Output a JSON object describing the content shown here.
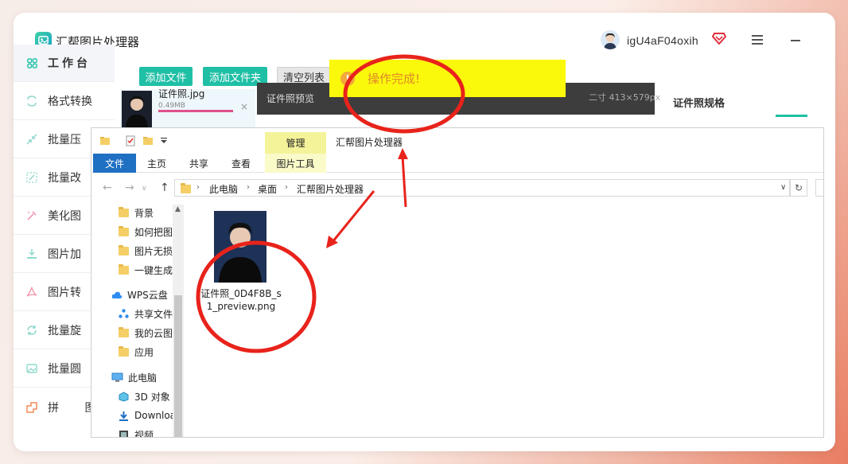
{
  "app": {
    "title": "汇帮图片处理器",
    "username": "igU4aF04oxih"
  },
  "sidebar": {
    "items": [
      {
        "label": "工作台",
        "icon": "grid-icon"
      },
      {
        "label": "格式转换",
        "icon": "convert-icon"
      },
      {
        "label": "批量压",
        "icon": "compress-icon"
      },
      {
        "label": "批量改",
        "icon": "resize-icon"
      },
      {
        "label": "美化图",
        "icon": "beautify-icon"
      },
      {
        "label": "图片加",
        "icon": "watermark-icon"
      },
      {
        "label": "图片转",
        "icon": "pdf-icon"
      },
      {
        "label": "批量旋",
        "icon": "rotate-icon"
      },
      {
        "label": "批量圆",
        "icon": "image-icon"
      },
      {
        "label": "拼 图",
        "icon": "puzzle-icon"
      }
    ]
  },
  "toolbar": {
    "add_file": "添加文件",
    "add_folder": "添加文件夹",
    "clear_list": "清空列表"
  },
  "toast": {
    "icon": "!",
    "text": "操作完成!"
  },
  "file_list": {
    "name": "证件照.jpg",
    "size": "0.49MB",
    "close": "×"
  },
  "preview": {
    "title": "证件照预览",
    "size_info": "二寸 413×579px"
  },
  "spec": {
    "title": "证件照规格"
  },
  "explorer": {
    "window_title": "汇帮图片处理器",
    "tabs": {
      "file": "文件",
      "home": "主页",
      "share": "共享",
      "view": "查看",
      "manage": "管理",
      "picture_tools": "图片工具"
    },
    "breadcrumb": [
      "此电脑",
      "桌面",
      "汇帮图片处理器"
    ],
    "nav_items": [
      {
        "label": "背景",
        "type": "folder"
      },
      {
        "label": "如何把图",
        "type": "folder"
      },
      {
        "label": "图片无损",
        "type": "folder"
      },
      {
        "label": "一键生成",
        "type": "folder"
      },
      {
        "label": "WPS云盘",
        "type": "cloud"
      },
      {
        "label": "共享文件",
        "type": "share"
      },
      {
        "label": "我的云图",
        "type": "folder"
      },
      {
        "label": "应用",
        "type": "folder"
      },
      {
        "label": "此电脑",
        "type": "pc"
      },
      {
        "label": "3D 对象",
        "type": "3d"
      },
      {
        "label": "Downloa",
        "type": "download"
      },
      {
        "label": "视频",
        "type": "video"
      }
    ],
    "file": {
      "name": "证件照_0D4F8B_s1_preview.png"
    }
  },
  "colors": {
    "accent": "#1fbfa6",
    "toast_bg": "#fbf90b",
    "annotation": "#e8231b",
    "ribbon_file_tab": "#1f6fc2"
  }
}
